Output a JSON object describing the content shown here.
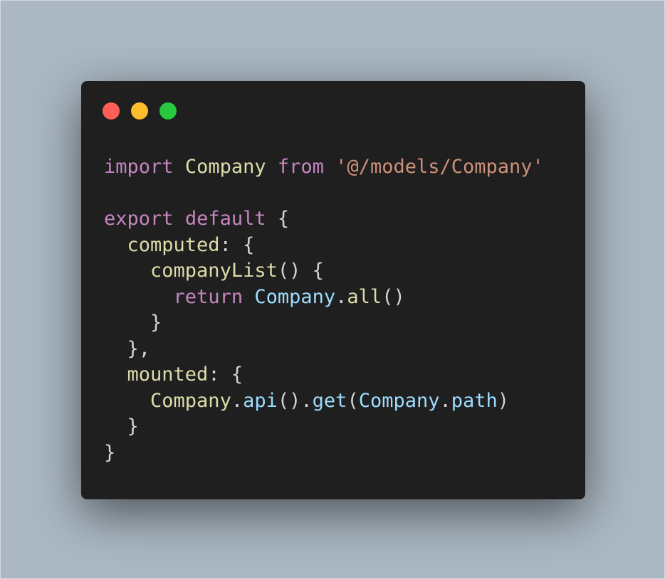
{
  "background_color": "#abb8c3",
  "window": {
    "background_color": "#1f1f1f",
    "controls": [
      {
        "name": "close-control",
        "icon": "red-circle-icon",
        "color": "#ff5f56"
      },
      {
        "name": "minimize-control",
        "icon": "yellow-circle-icon",
        "color": "#ffbd2e"
      },
      {
        "name": "maximize-control",
        "icon": "green-circle-icon",
        "color": "#27c93f"
      }
    ]
  },
  "syntax_colors": {
    "keyword": "#c586c0",
    "identifier": "#dcdcaa",
    "string": "#ce9178",
    "variable": "#9cdcfe",
    "punctuation": "#d4d4d4"
  },
  "code_lines": [
    [
      {
        "text": "import",
        "kind": "keyword"
      },
      {
        "text": " ",
        "kind": "punctuation"
      },
      {
        "text": "Company",
        "kind": "identifier"
      },
      {
        "text": " ",
        "kind": "punctuation"
      },
      {
        "text": "from",
        "kind": "keyword"
      },
      {
        "text": " ",
        "kind": "punctuation"
      },
      {
        "text": "'@/models/Company'",
        "kind": "string"
      }
    ],
    [],
    [
      {
        "text": "export",
        "kind": "keyword"
      },
      {
        "text": " ",
        "kind": "punctuation"
      },
      {
        "text": "default",
        "kind": "keyword"
      },
      {
        "text": " {",
        "kind": "punctuation"
      }
    ],
    [
      {
        "text": "  ",
        "kind": "punctuation"
      },
      {
        "text": "computed",
        "kind": "identifier"
      },
      {
        "text": ": {",
        "kind": "punctuation"
      }
    ],
    [
      {
        "text": "    ",
        "kind": "punctuation"
      },
      {
        "text": "companyList",
        "kind": "identifier"
      },
      {
        "text": "() {",
        "kind": "punctuation"
      }
    ],
    [
      {
        "text": "      ",
        "kind": "punctuation"
      },
      {
        "text": "return",
        "kind": "keyword"
      },
      {
        "text": " ",
        "kind": "punctuation"
      },
      {
        "text": "Company",
        "kind": "variable"
      },
      {
        "text": ".",
        "kind": "punctuation"
      },
      {
        "text": "all",
        "kind": "identifier"
      },
      {
        "text": "()",
        "kind": "punctuation"
      }
    ],
    [
      {
        "text": "    }",
        "kind": "punctuation"
      }
    ],
    [
      {
        "text": "  },",
        "kind": "punctuation"
      }
    ],
    [
      {
        "text": "  ",
        "kind": "punctuation"
      },
      {
        "text": "mounted",
        "kind": "identifier"
      },
      {
        "text": ": {",
        "kind": "punctuation"
      }
    ],
    [
      {
        "text": "    ",
        "kind": "punctuation"
      },
      {
        "text": "Company",
        "kind": "identifier"
      },
      {
        "text": ".",
        "kind": "punctuation"
      },
      {
        "text": "api",
        "kind": "variable"
      },
      {
        "text": "().",
        "kind": "punctuation"
      },
      {
        "text": "get",
        "kind": "variable"
      },
      {
        "text": "(",
        "kind": "punctuation"
      },
      {
        "text": "Company",
        "kind": "variable"
      },
      {
        "text": ".",
        "kind": "punctuation"
      },
      {
        "text": "path",
        "kind": "variable"
      },
      {
        "text": ")",
        "kind": "punctuation"
      }
    ],
    [
      {
        "text": "  }",
        "kind": "punctuation"
      }
    ],
    [
      {
        "text": "}",
        "kind": "punctuation"
      }
    ]
  ]
}
